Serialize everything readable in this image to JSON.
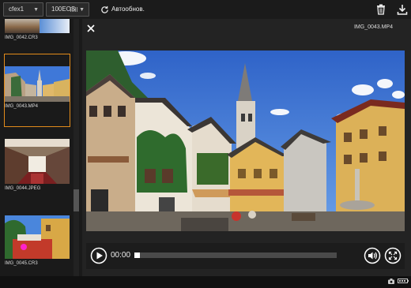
{
  "toolbar": {
    "folder_select": "cfex1",
    "camera_select": "100EOS",
    "autorefresh_label": "Автообнов."
  },
  "thumbnails": [
    {
      "caption": "IMG_0042.CR3"
    },
    {
      "caption": "IMG_0043.MP4",
      "selected": true
    },
    {
      "caption": "IMG_0044.JPEG"
    },
    {
      "caption": "IMG_0045.CR3"
    }
  ],
  "viewer": {
    "filename": "IMG_0043.MP4",
    "time": "00:00",
    "progress": 0
  },
  "colors": {
    "selection": "#e38b1b",
    "sky": "#3a6fd0"
  },
  "icons": {
    "refresh": "refresh-icon",
    "trash": "trash-icon",
    "download": "download-icon",
    "close": "close-icon",
    "play": "play-icon",
    "volume": "volume-icon",
    "fullscreen": "fullscreen-icon",
    "camera": "camera-icon",
    "battery": "battery-icon"
  }
}
